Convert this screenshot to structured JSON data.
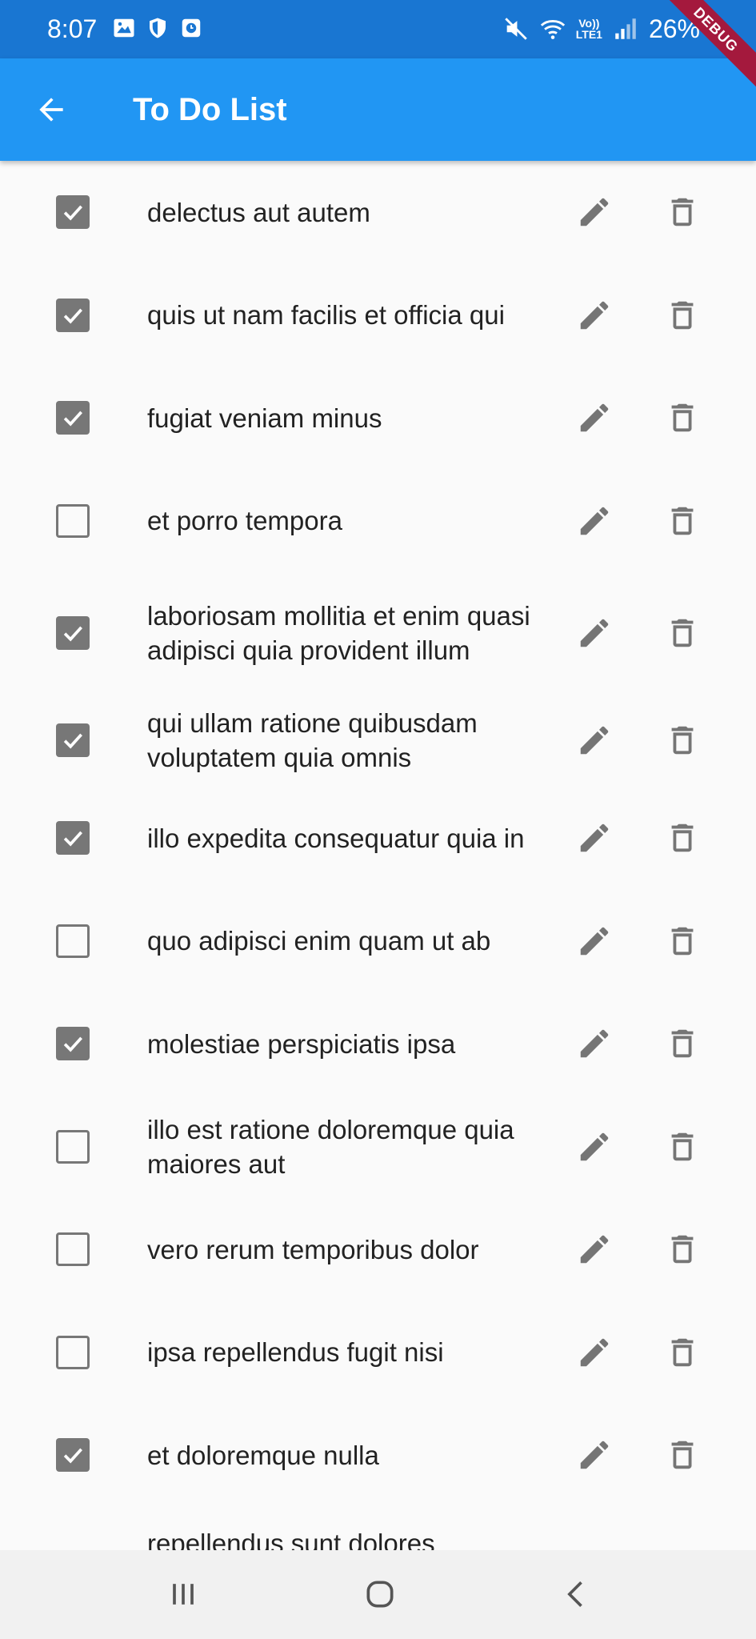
{
  "status_bar": {
    "time": "8:07",
    "lte_top": "Vo))",
    "lte_bottom": "LTE1",
    "battery": "26%",
    "debug_label": "DEBUG"
  },
  "app_bar": {
    "title": "To Do List"
  },
  "todos": [
    {
      "title": "delectus aut autem",
      "completed": true
    },
    {
      "title": "quis ut nam facilis et officia qui",
      "completed": true
    },
    {
      "title": "fugiat veniam minus",
      "completed": true
    },
    {
      "title": "et porro tempora",
      "completed": false
    },
    {
      "title": "laboriosam mollitia et enim quasi adipisci quia provident illum",
      "completed": true
    },
    {
      "title": "qui ullam ratione quibusdam voluptatem quia omnis",
      "completed": true
    },
    {
      "title": "illo expedita consequatur quia in",
      "completed": true
    },
    {
      "title": "quo adipisci enim quam ut ab",
      "completed": false
    },
    {
      "title": "molestiae perspiciatis ipsa",
      "completed": true
    },
    {
      "title": "illo est ratione doloremque quia maiores aut",
      "completed": false
    },
    {
      "title": "vero rerum temporibus dolor",
      "completed": false
    },
    {
      "title": "ipsa repellendus fugit nisi",
      "completed": false
    },
    {
      "title": "et doloremque nulla",
      "completed": true
    },
    {
      "title": "repellendus sunt dolores",
      "completed": false
    }
  ],
  "colors": {
    "status_bar": "#1976d2",
    "app_bar": "#2196f3",
    "checkbox": "#777777",
    "icon": "#757575",
    "debug_banner": "#a4193d"
  },
  "icons": {
    "back": "arrow-back-icon",
    "edit": "pencil-icon",
    "delete": "trash-icon",
    "nav_recents": "recents-icon",
    "nav_home": "home-icon",
    "nav_back": "chevron-left-icon"
  }
}
